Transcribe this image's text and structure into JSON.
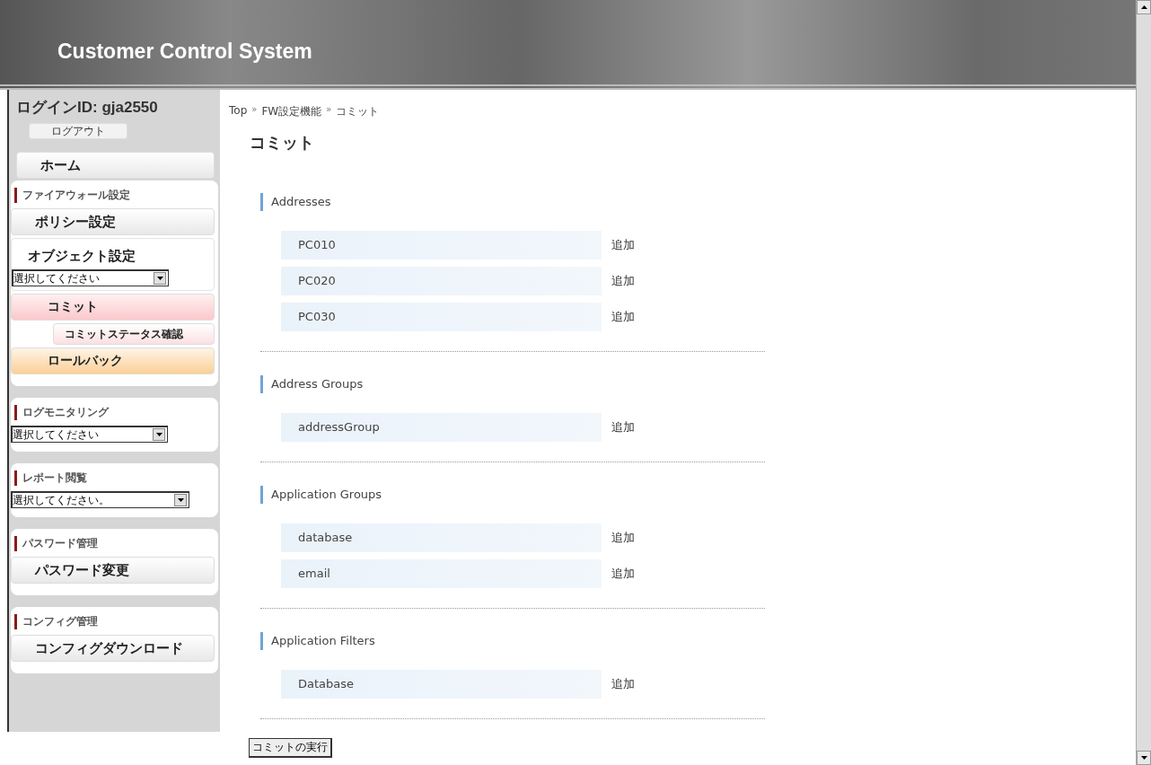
{
  "header": {
    "title": "Customer Control System"
  },
  "sidebar": {
    "login": "ログインID: gja2550",
    "logout_button": "ログアウト",
    "home_button": "ホーム",
    "sections": [
      {
        "title": "ファイアウォール設定",
        "items": [
          {
            "kind": "button",
            "label": "ポリシー設定"
          },
          {
            "kind": "button-with-select",
            "label": "オブジェクト設定",
            "select_value": "選択してください"
          },
          {
            "kind": "pink-button",
            "label": "コミット"
          },
          {
            "kind": "sub-button",
            "label": "コミットステータス確認"
          },
          {
            "kind": "orange-button",
            "label": "ロールバック"
          }
        ]
      },
      {
        "title": "ログモニタリング",
        "items": [
          {
            "kind": "select",
            "label": "選択してください"
          }
        ]
      },
      {
        "title": "レポート閲覧",
        "items": [
          {
            "kind": "wide-select",
            "label": "選択してください。"
          }
        ]
      },
      {
        "title": "パスワード管理",
        "items": [
          {
            "kind": "button",
            "label": "パスワード変更"
          }
        ]
      },
      {
        "title": "コンフィグ管理",
        "items": [
          {
            "kind": "button",
            "label": "コンフィグダウンロード"
          }
        ]
      }
    ]
  },
  "breadcrumb": {
    "items": [
      "Top",
      "FW設定機能",
      "コミット"
    ],
    "separator": "»"
  },
  "page_title": "コミット",
  "groups": [
    {
      "title": "Addresses",
      "items": [
        {
          "name": "PC010",
          "action": "追加"
        },
        {
          "name": "PC020",
          "action": "追加"
        },
        {
          "name": "PC030",
          "action": "追加"
        }
      ]
    },
    {
      "title": "Address Groups",
      "items": [
        {
          "name": "addressGroup",
          "action": "追加"
        }
      ]
    },
    {
      "title": "Application Groups",
      "items": [
        {
          "name": "database",
          "action": "追加"
        },
        {
          "name": "email",
          "action": "追加"
        }
      ]
    },
    {
      "title": "Application Filters",
      "items": [
        {
          "name": "Database",
          "action": "追加"
        }
      ]
    }
  ],
  "commit_button": "コミットの実行"
}
